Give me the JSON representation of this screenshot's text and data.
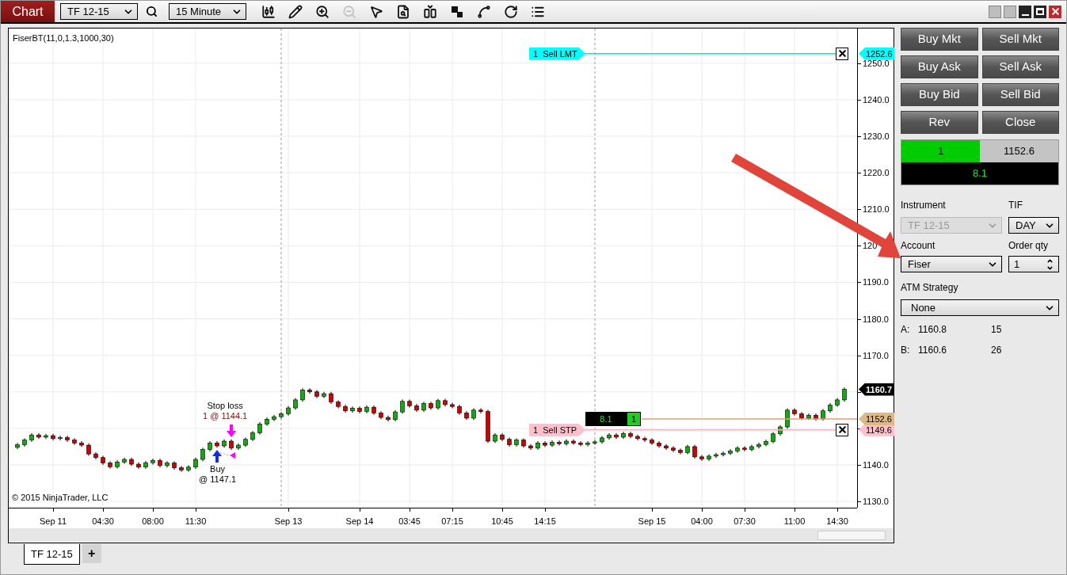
{
  "toolbar": {
    "tab_label": "Chart",
    "instrument": "TF 12-15",
    "interval": "15 Minute",
    "tools": [
      {
        "kind": "candles",
        "disabled": false
      },
      {
        "kind": "pencil",
        "disabled": false
      },
      {
        "kind": "zoom_in",
        "disabled": false
      },
      {
        "kind": "zoom_out",
        "disabled": true
      },
      {
        "kind": "pointer",
        "disabled": false
      },
      {
        "kind": "data_box",
        "disabled": false
      },
      {
        "kind": "spacing",
        "disabled": false
      },
      {
        "kind": "squares",
        "disabled": false
      },
      {
        "kind": "nodes",
        "disabled": false
      },
      {
        "kind": "refresh",
        "disabled": false
      },
      {
        "kind": "list",
        "disabled": false
      }
    ]
  },
  "chart": {
    "indicator_label": "FiserBT(11,0,1.3,1000,30)",
    "copyright": "© 2015 NinjaTrader, LLC",
    "covered_axis_label": "120",
    "chart_data": {
      "type": "candlestick",
      "grid": true,
      "ylim": [
        1128.5,
        1259.5
      ],
      "categories": [
        null,
        null,
        null,
        null,
        null,
        "Sep 11",
        null,
        null,
        null,
        null,
        null,
        null,
        "04:30",
        null,
        null,
        null,
        null,
        null,
        null,
        "08:00",
        null,
        null,
        null,
        null,
        null,
        "11:30",
        null,
        null,
        null,
        null,
        null,
        null,
        null,
        null,
        null,
        null,
        null,
        null,
        "Sep 13",
        null,
        null,
        null,
        null,
        null,
        null,
        null,
        null,
        null,
        "Sep 14",
        null,
        null,
        null,
        null,
        null,
        null,
        "03:45",
        null,
        null,
        null,
        null,
        null,
        "07:15",
        null,
        null,
        null,
        null,
        null,
        null,
        "10:45",
        null,
        null,
        null,
        null,
        null,
        "14:15",
        null,
        null,
        null,
        null,
        null,
        null,
        null,
        null,
        null,
        null,
        null,
        null,
        null,
        null,
        "Sep 15",
        null,
        null,
        null,
        null,
        null,
        null,
        "04:00",
        null,
        null,
        null,
        null,
        null,
        "07:30",
        null,
        null,
        null,
        null,
        null,
        null,
        "11:00",
        null,
        null,
        null,
        null,
        null,
        "14:30",
        null
      ],
      "yticks": [
        {
          "value": 1250,
          "label": "1250.0"
        },
        {
          "value": 1240,
          "label": "1240.0"
        },
        {
          "value": 1230,
          "label": "1230.0"
        },
        {
          "value": 1220,
          "label": "1220.0"
        },
        {
          "value": 1210,
          "label": "1210.0"
        },
        {
          "value": 1190,
          "label": "1190.0"
        },
        {
          "value": 1180,
          "label": "1180.0"
        },
        {
          "value": 1170,
          "label": "1170.0"
        },
        {
          "value": 1140,
          "label": "1140.0"
        },
        {
          "value": 1130,
          "label": "1130.0"
        }
      ],
      "ohlc": [
        [
          1144.8,
          1146.0,
          1144.3,
          1145.5
        ],
        [
          1145.5,
          1147.3,
          1145.0,
          1146.8
        ],
        [
          1146.8,
          1148.7,
          1146.3,
          1148.2
        ],
        [
          1148.2,
          1148.7,
          1147.1,
          1147.6
        ],
        [
          1147.6,
          1148.5,
          1147.1,
          1148.0
        ],
        [
          1148.0,
          1148.5,
          1146.7,
          1147.2
        ],
        [
          1147.2,
          1148.0,
          1146.7,
          1147.5
        ],
        [
          1147.5,
          1148.0,
          1146.3,
          1146.8
        ],
        [
          1146.8,
          1147.3,
          1145.5,
          1146.0
        ],
        [
          1146.0,
          1146.5,
          1144.9,
          1145.4
        ],
        [
          1145.4,
          1145.9,
          1142.5,
          1143.0
        ],
        [
          1143.0,
          1143.5,
          1141.5,
          1142.0
        ],
        [
          1142.0,
          1142.5,
          1140.0,
          1140.5
        ],
        [
          1140.5,
          1141.0,
          1139.0,
          1139.5
        ],
        [
          1139.5,
          1141.3,
          1139.0,
          1140.8
        ],
        [
          1140.8,
          1142.0,
          1140.3,
          1141.5
        ],
        [
          1141.5,
          1142.0,
          1139.7,
          1140.2
        ],
        [
          1140.2,
          1140.7,
          1138.9,
          1139.4
        ],
        [
          1139.4,
          1141.1,
          1138.9,
          1140.6
        ],
        [
          1140.6,
          1141.7,
          1140.1,
          1141.2
        ],
        [
          1141.2,
          1141.7,
          1139.3,
          1139.8
        ],
        [
          1139.8,
          1141.0,
          1139.3,
          1140.5
        ],
        [
          1140.5,
          1141.0,
          1138.7,
          1139.2
        ],
        [
          1139.2,
          1139.7,
          1138.1,
          1138.6
        ],
        [
          1138.6,
          1139.9,
          1138.1,
          1139.4
        ],
        [
          1139.4,
          1142.0,
          1138.9,
          1141.5
        ],
        [
          1141.5,
          1144.7,
          1141.0,
          1144.2
        ],
        [
          1144.2,
          1146.5,
          1143.7,
          1146.0
        ],
        [
          1146.0,
          1146.5,
          1144.7,
          1145.2
        ],
        [
          1145.2,
          1147.0,
          1144.7,
          1146.5
        ],
        [
          1146.5,
          1147.0,
          1144.1,
          1144.6
        ],
        [
          1144.6,
          1145.9,
          1144.1,
          1145.4
        ],
        [
          1145.4,
          1147.5,
          1144.9,
          1147.0
        ],
        [
          1147.0,
          1149.3,
          1146.5,
          1148.8
        ],
        [
          1148.8,
          1151.7,
          1148.3,
          1151.2
        ],
        [
          1151.2,
          1153.0,
          1150.7,
          1152.5
        ],
        [
          1152.5,
          1153.7,
          1152.0,
          1153.2
        ],
        [
          1153.2,
          1154.5,
          1152.7,
          1154.0
        ],
        [
          1154.0,
          1156.1,
          1153.5,
          1155.6
        ],
        [
          1155.6,
          1158.3,
          1155.1,
          1157.8
        ],
        [
          1157.8,
          1161.0,
          1157.3,
          1160.5
        ],
        [
          1160.5,
          1161.0,
          1159.5,
          1160.0
        ],
        [
          1160.0,
          1160.5,
          1158.3,
          1158.8
        ],
        [
          1158.8,
          1160.0,
          1158.3,
          1159.5
        ],
        [
          1159.5,
          1160.0,
          1156.7,
          1157.2
        ],
        [
          1157.2,
          1157.7,
          1155.5,
          1156.0
        ],
        [
          1156.0,
          1156.5,
          1154.3,
          1154.8
        ],
        [
          1154.8,
          1156.0,
          1154.3,
          1155.5
        ],
        [
          1155.5,
          1156.0,
          1154.1,
          1154.6
        ],
        [
          1154.6,
          1156.3,
          1154.1,
          1155.8
        ],
        [
          1155.8,
          1156.3,
          1153.7,
          1154.2
        ],
        [
          1154.2,
          1154.7,
          1152.5,
          1153.0
        ],
        [
          1153.0,
          1153.5,
          1151.9,
          1152.4
        ],
        [
          1152.4,
          1155.0,
          1151.9,
          1154.5
        ],
        [
          1154.5,
          1157.9,
          1154.0,
          1157.4
        ],
        [
          1157.4,
          1157.9,
          1155.7,
          1156.2
        ],
        [
          1156.2,
          1156.7,
          1154.5,
          1155.0
        ],
        [
          1155.0,
          1157.3,
          1154.5,
          1156.8
        ],
        [
          1156.8,
          1157.3,
          1155.1,
          1155.6
        ],
        [
          1155.6,
          1158.1,
          1155.1,
          1157.6
        ],
        [
          1157.6,
          1158.1,
          1156.0,
          1156.5
        ],
        [
          1156.5,
          1157.0,
          1155.5,
          1156.0
        ],
        [
          1156.0,
          1156.5,
          1153.7,
          1154.2
        ],
        [
          1154.2,
          1154.7,
          1152.3,
          1152.8
        ],
        [
          1152.8,
          1155.5,
          1152.3,
          1155.0
        ],
        [
          1155.0,
          1155.5,
          1154.1,
          1154.6
        ],
        [
          1154.6,
          1155.1,
          1146.0,
          1146.5
        ],
        [
          1146.5,
          1148.7,
          1146.0,
          1148.2
        ],
        [
          1148.2,
          1148.7,
          1146.5,
          1147.0
        ],
        [
          1147.0,
          1147.5,
          1145.0,
          1145.5
        ],
        [
          1145.5,
          1147.3,
          1145.0,
          1146.8
        ],
        [
          1146.8,
          1147.3,
          1144.7,
          1145.2
        ],
        [
          1145.2,
          1145.7,
          1144.1,
          1144.6
        ],
        [
          1144.6,
          1146.5,
          1144.1,
          1146.0
        ],
        [
          1146.0,
          1146.5,
          1144.9,
          1145.4
        ],
        [
          1145.4,
          1146.7,
          1144.9,
          1146.2
        ],
        [
          1146.2,
          1146.7,
          1145.3,
          1145.8
        ],
        [
          1145.8,
          1147.0,
          1145.3,
          1146.5
        ],
        [
          1146.5,
          1147.0,
          1145.5,
          1146.0
        ],
        [
          1146.0,
          1146.5,
          1145.1,
          1145.6
        ],
        [
          1145.6,
          1146.5,
          1145.1,
          1146.0
        ],
        [
          1146.0,
          1146.8,
          1145.5,
          1146.3
        ],
        [
          1146.3,
          1147.9,
          1145.8,
          1147.4
        ],
        [
          1147.4,
          1148.7,
          1146.9,
          1148.2
        ],
        [
          1148.2,
          1148.7,
          1147.1,
          1147.6
        ],
        [
          1147.6,
          1149.1,
          1147.1,
          1148.6
        ],
        [
          1148.6,
          1149.1,
          1147.3,
          1147.8
        ],
        [
          1147.8,
          1148.3,
          1146.7,
          1147.2
        ],
        [
          1147.2,
          1147.7,
          1146.3,
          1146.8
        ],
        [
          1146.8,
          1147.3,
          1145.5,
          1146.0
        ],
        [
          1146.0,
          1146.5,
          1144.7,
          1145.2
        ],
        [
          1145.2,
          1145.7,
          1144.1,
          1144.6
        ],
        [
          1144.6,
          1145.1,
          1143.5,
          1144.0
        ],
        [
          1144.0,
          1144.5,
          1142.9,
          1143.4
        ],
        [
          1143.4,
          1145.5,
          1142.9,
          1145.0
        ],
        [
          1145.0,
          1145.5,
          1141.7,
          1142.2
        ],
        [
          1142.2,
          1142.7,
          1141.1,
          1141.6
        ],
        [
          1141.6,
          1142.9,
          1141.1,
          1142.4
        ],
        [
          1142.4,
          1143.3,
          1141.9,
          1142.8
        ],
        [
          1142.8,
          1143.7,
          1142.3,
          1143.2
        ],
        [
          1143.2,
          1144.3,
          1142.7,
          1143.8
        ],
        [
          1143.8,
          1145.1,
          1143.3,
          1144.6
        ],
        [
          1144.6,
          1145.1,
          1143.7,
          1144.2
        ],
        [
          1144.2,
          1145.5,
          1143.7,
          1145.0
        ],
        [
          1145.0,
          1146.1,
          1144.5,
          1145.6
        ],
        [
          1145.6,
          1146.9,
          1145.1,
          1146.4
        ],
        [
          1146.4,
          1149.0,
          1145.9,
          1148.5
        ],
        [
          1148.5,
          1150.9,
          1148.0,
          1150.4
        ],
        [
          1150.4,
          1155.5,
          1149.9,
          1155.0
        ],
        [
          1155.0,
          1155.5,
          1153.5,
          1154.0
        ],
        [
          1154.0,
          1154.5,
          1152.3,
          1152.8
        ],
        [
          1152.8,
          1154.1,
          1152.3,
          1153.6
        ],
        [
          1153.6,
          1154.1,
          1152.1,
          1152.6
        ],
        [
          1152.6,
          1155.3,
          1152.1,
          1154.8
        ],
        [
          1154.8,
          1156.9,
          1154.3,
          1156.4
        ],
        [
          1156.4,
          1158.3,
          1155.9,
          1157.8
        ],
        [
          1157.8,
          1161.2,
          1157.3,
          1160.7
        ]
      ]
    },
    "orders": [
      {
        "kind": "limit",
        "label": "1  Sell LMT",
        "price_tag": "1252.6"
      },
      {
        "kind": "stop",
        "label": "1  Sell STP",
        "price_tag": "1149.6"
      }
    ],
    "position": {
      "pnl": "8.1",
      "qty": "1",
      "price_tag": "1152.6"
    },
    "last_price": "1160.7",
    "executions": [
      {
        "kind": "stop",
        "lines": [
          "Stop loss",
          "1 @ 1144.1"
        ]
      },
      {
        "kind": "buy",
        "lines": [
          "Buy",
          "@ 1147.1"
        ]
      }
    ]
  },
  "panel": {
    "buttons": [
      "Buy Mkt",
      "Sell Mkt",
      "Buy Ask",
      "Sell Ask",
      "Buy Bid",
      "Sell Bid",
      "Rev",
      "Close"
    ],
    "position": {
      "qty": "1",
      "avg_price": "1152.6",
      "pnl": "8.1"
    },
    "instrument": {
      "label": "Instrument",
      "value": "TF 12-15",
      "disabled": true
    },
    "tif": {
      "label": "TIF",
      "value": "DAY"
    },
    "account": {
      "label": "Account",
      "value": "Fiser"
    },
    "order_qty": {
      "label": "Order qty",
      "value": "1"
    },
    "atm": {
      "label": "ATM Strategy",
      "value": "None"
    },
    "quotes": [
      {
        "side": "A:",
        "price": "1160.8",
        "size": "15"
      },
      {
        "side": "B:",
        "price": "1160.6",
        "size": "26"
      }
    ]
  },
  "tabs": [
    {
      "label": "TF 12-15",
      "selected": true
    }
  ],
  "add_tab": "+"
}
